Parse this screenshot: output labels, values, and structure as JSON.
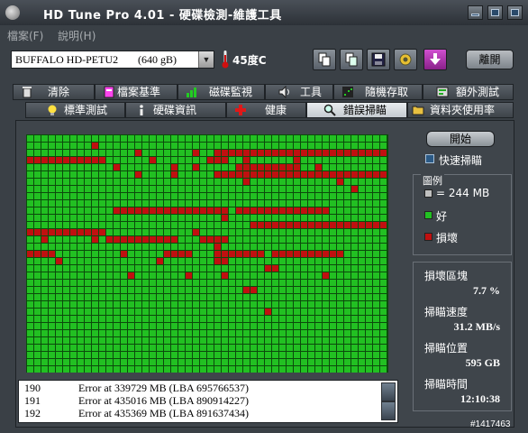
{
  "window": {
    "title": "HD Tune Pro 4.01 - 硬碟檢測-維護工具"
  },
  "menu": [
    {
      "label": "檔案(F)"
    },
    {
      "label": "說明(H)"
    }
  ],
  "drive": {
    "name": "BUFFALO HD-PETU2",
    "capacity": "(640 gB)",
    "temperature": "45度C"
  },
  "toolbar": {
    "exit_label": "離開"
  },
  "tabs_top": [
    {
      "label": "清除",
      "icon": "trash-icon"
    },
    {
      "label": "檔案基準",
      "icon": "file-benchmark-icon"
    },
    {
      "label": "磁碟監視",
      "icon": "disk-monitor-icon"
    },
    {
      "label": "工具",
      "icon": "speaker-icon"
    },
    {
      "label": "隨機存取",
      "icon": "random-access-icon"
    },
    {
      "label": "額外測試",
      "icon": "extra-tests-icon"
    }
  ],
  "tabs_bottom": [
    {
      "label": "標準測試",
      "icon": "bulb-icon",
      "active": false
    },
    {
      "label": "硬碟資訊",
      "icon": "info-icon",
      "active": false
    },
    {
      "label": "健康",
      "icon": "health-cross-icon",
      "active": false
    },
    {
      "label": "錯誤掃瞄",
      "icon": "magnifier-icon",
      "active": true
    },
    {
      "label": "資料夾使用率",
      "icon": "folder-icon",
      "active": false
    }
  ],
  "scan": {
    "start_label": "開始",
    "quick_scan_label": "快速掃瞄",
    "quick_scan_checked": true,
    "legend_title": "圖例",
    "legend": [
      {
        "label": "= 244 MB",
        "color": "#c0c0c0"
      },
      {
        "label": "好",
        "color": "#22c022"
      },
      {
        "label": "損壞",
        "color": "#c01010"
      }
    ],
    "stats": {
      "damaged_label": "損壞區塊",
      "damaged_value": "7.7 %",
      "speed_label": "掃瞄速度",
      "speed_value": "31.2 MB/s",
      "position_label": "掃瞄位置",
      "position_value": "595 GB",
      "time_label": "掃瞄時間",
      "time_value": "12:10:38"
    },
    "grid": {
      "cols": 50,
      "rows": 33,
      "good_color": "#22c022",
      "bad_color": "#c01010"
    },
    "log": [
      {
        "num": "190",
        "msg": "Error at 339729 MB (LBA 695766537)"
      },
      {
        "num": "191",
        "msg": "Error at 435016 MB (LBA 890914227)"
      },
      {
        "num": "192",
        "msg": "Error at 435369 MB (LBA 891637434)"
      }
    ]
  },
  "watermark": "#1417463",
  "colors": {
    "accent": "#3a4046",
    "good": "#22c022",
    "bad": "#c01010"
  }
}
